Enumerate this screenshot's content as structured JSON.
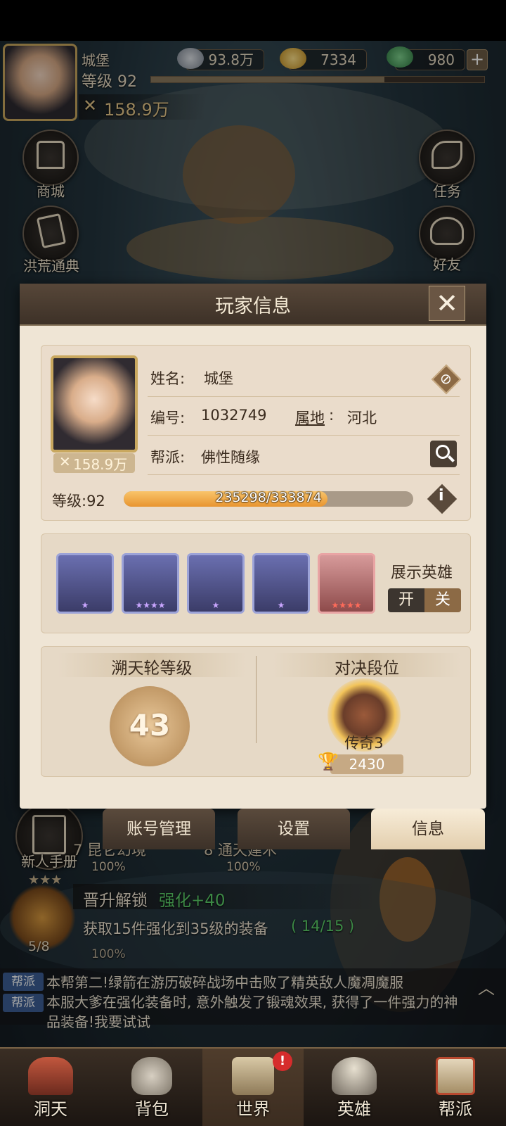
{
  "hud": {
    "player_name": "城堡",
    "level_text": "等级 92",
    "power": "158.9万",
    "silver": "93.8万",
    "gold": "7334",
    "jade": "980",
    "plus": "+"
  },
  "side_buttons": {
    "shop": "商城",
    "codex": "洪荒通典",
    "quest": "任务",
    "friends": "好友",
    "newbie": "新人手册"
  },
  "dialog": {
    "title": "玩家信息",
    "name_label": "姓名:",
    "name_value": "城堡",
    "id_label": "编号:",
    "id_value": "1032749",
    "region_label": "属地",
    "region_value": "河北",
    "region_sep": ":",
    "guild_label": "帮派:",
    "guild_value": "佛性随缘",
    "avatar_power": "158.9万",
    "level_label": "等级:92",
    "exp_current": 235298,
    "exp_max": 333874,
    "exp_text": "235298/333874",
    "show_heroes_label": "展示英雄",
    "toggle_on": "开",
    "toggle_off": "关",
    "wheel_title": "溯天轮等级",
    "wheel_level": "43",
    "rank_title": "对决段位",
    "rank_name": "传奇3",
    "rank_points": "2430",
    "heroes": [
      {
        "stars": "★",
        "frame": "blue"
      },
      {
        "stars": "★★★★",
        "frame": "blue"
      },
      {
        "stars": "★",
        "frame": "blue"
      },
      {
        "stars": "★",
        "frame": "blue"
      },
      {
        "stars": "★★★★",
        "frame": "red"
      }
    ]
  },
  "tabs": {
    "account": "账号管理",
    "settings": "设置",
    "info": "信息"
  },
  "world": {
    "stage7": "7 昆仑幻境",
    "stage7_pct": "100%",
    "stage8": "8 通天建木",
    "stage8_pct": "100%",
    "promote_label": "晋升解锁",
    "promote_reward": "强化+40",
    "task_progress": "5/8",
    "task_text": "获取15件强化到35级的装备",
    "task_count": "( 14/15 )",
    "pct_behind": "100%"
  },
  "chat": [
    {
      "tag": "帮派",
      "text": "本帮第二!绿箭在游历破碎战场中击败了精英敌人魔凋魔服"
    },
    {
      "tag": "帮派",
      "text": "本服大爹在强化装备时, 意外触发了锻魂效果, 获得了一件强力的神品装备!我要试试"
    }
  ],
  "nav": {
    "home": "洞天",
    "bag": "背包",
    "world": "世界",
    "heroes": "英雄",
    "guild": "帮派",
    "badge": "!"
  },
  "colors": {
    "exp_fill": "#f0a842",
    "reward_green": "#5cd16a",
    "chat_tag": "#3c5f95",
    "accent_brown": "#8c6a45"
  }
}
